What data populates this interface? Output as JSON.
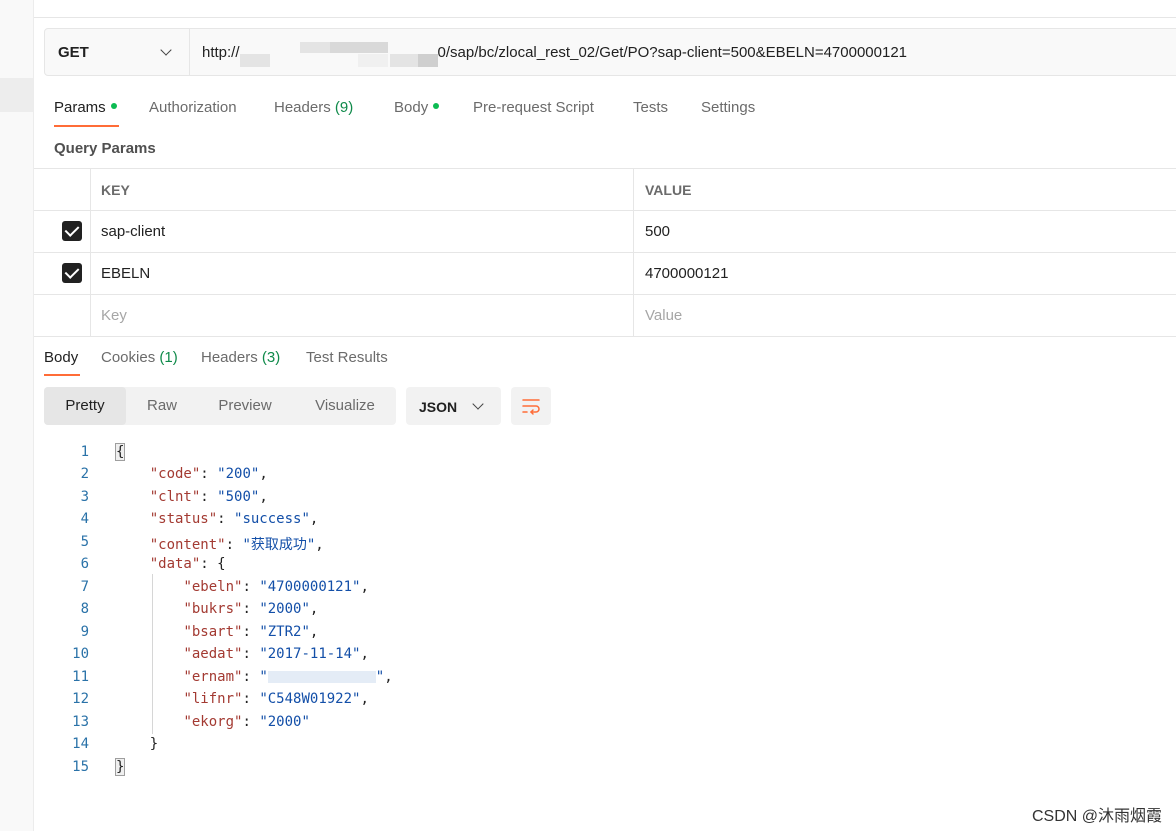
{
  "request": {
    "method": "GET",
    "url_prefix": "http://",
    "url_suffix": "0/sap/bc/zlocal_rest_02/Get/PO?sap-client=500&EBELN=4700000121"
  },
  "request_tabs": {
    "params": "Params",
    "authorization": "Authorization",
    "headers": "Headers",
    "headers_count": "(9)",
    "body": "Body",
    "pre_request": "Pre-request Script",
    "tests": "Tests",
    "settings": "Settings"
  },
  "query_params": {
    "title": "Query Params",
    "headers": {
      "key": "KEY",
      "value": "VALUE"
    },
    "rows": [
      {
        "key": "sap-client",
        "value": "500",
        "checked": true
      },
      {
        "key": "EBELN",
        "value": "4700000121",
        "checked": true
      }
    ],
    "placeholder_key": "Key",
    "placeholder_value": "Value"
  },
  "response_tabs": {
    "body": "Body",
    "cookies": "Cookies",
    "cookies_count": "(1)",
    "headers": "Headers",
    "headers_count": "(3)",
    "test_results": "Test Results"
  },
  "view_modes": {
    "pretty": "Pretty",
    "raw": "Raw",
    "preview": "Preview",
    "visualize": "Visualize",
    "format": "JSON"
  },
  "response_body": {
    "line_numbers": [
      "1",
      "2",
      "3",
      "4",
      "5",
      "6",
      "7",
      "8",
      "9",
      "10",
      "11",
      "12",
      "13",
      "14",
      "15"
    ],
    "open_brace": "{",
    "close_brace": "}",
    "inner_close": "}",
    "fields": [
      {
        "key": "\"code\"",
        "value": "\"200\""
      },
      {
        "key": "\"clnt\"",
        "value": "\"500\""
      },
      {
        "key": "\"status\"",
        "value": "\"success\""
      },
      {
        "key": "\"content\"",
        "value": "\"获取成功\""
      },
      {
        "key": "\"data\"",
        "value": "{"
      }
    ],
    "data_fields": [
      {
        "key": "\"ebeln\"",
        "value": "\"4700000121\""
      },
      {
        "key": "\"bukrs\"",
        "value": "\"2000\""
      },
      {
        "key": "\"bsart\"",
        "value": "\"ZTR2\""
      },
      {
        "key": "\"aedat\"",
        "value": "\"2017-11-14\""
      },
      {
        "key": "\"ernam\"",
        "value": "\""
      },
      {
        "key": "\"lifnr\"",
        "value": "\"C548W01922\""
      },
      {
        "key": "\"ekorg\"",
        "value": "\"2000\""
      }
    ],
    "ernam_close": "\""
  },
  "watermark": "CSDN @沐雨烟霞",
  "colors": {
    "accent": "#ff6c37",
    "dot": "#0cbb52",
    "json_key": "#a33a32",
    "json_string": "#134fa8"
  }
}
